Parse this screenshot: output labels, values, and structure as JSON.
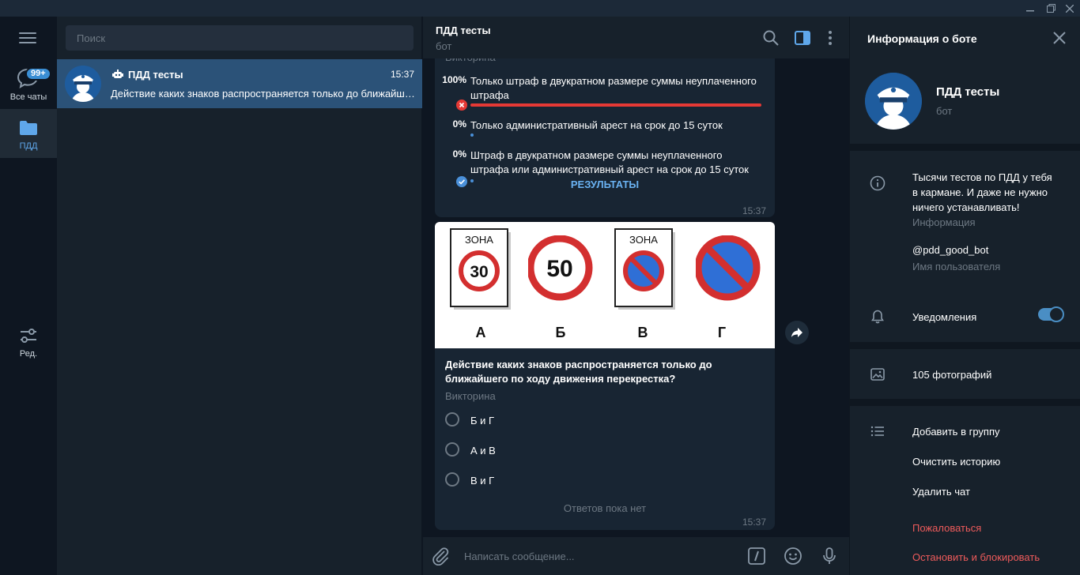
{
  "window": {
    "controls": [
      "minimize-icon",
      "maximize-icon",
      "close-icon"
    ]
  },
  "folders": {
    "items": [
      {
        "label": "Все чаты",
        "icon": "chat-bubbles-icon",
        "badge": "99+",
        "active": false
      },
      {
        "label": "ПДД",
        "icon": "folder-icon",
        "active": true
      },
      {
        "label": "Ред.",
        "icon": "edit-sliders-icon",
        "active": false
      }
    ]
  },
  "chatlist": {
    "search_placeholder": "Поиск",
    "chats": [
      {
        "name": "ПДД тесты",
        "time": "15:37",
        "preview": "Действие каких знаков распространяется только до ближайшего перекрестка?",
        "is_bot": true
      }
    ]
  },
  "chat": {
    "title": "ПДД тесты",
    "subtitle": "бот",
    "poll_header_partial": "Викторина",
    "poll1": {
      "options": [
        {
          "percent": "100%",
          "text": "Только штраф в двукратном размере суммы неуплаченного штрафа",
          "fill": 1.0,
          "mark": "wrong"
        },
        {
          "percent": "0%",
          "text": "Только административный арест на срок до 15 суток",
          "fill": 0.0,
          "mark": "none"
        },
        {
          "percent": "0%",
          "text": "Штраф в двукратном размере суммы неуплаченного штрафа или административный арест на срок до 15 суток",
          "fill": 0.0,
          "mark": "correct"
        }
      ],
      "results_label": "РЕЗУЛЬТАТЫ",
      "time": "15:37"
    },
    "image": {
      "signs": [
        {
          "caption": "А",
          "zone_label": "ЗОНА",
          "value": "30",
          "kind": "zone-speed-limit"
        },
        {
          "caption": "Б",
          "value": "50",
          "kind": "speed-limit"
        },
        {
          "caption": "В",
          "zone_label": "ЗОНА",
          "kind": "zone-no-parking"
        },
        {
          "caption": "Г",
          "kind": "no-parking"
        }
      ]
    },
    "poll2": {
      "question": "Действие каких знаков распространяется только до ближайшего по ходу движения перекрестка?",
      "kind": "Викторина",
      "options": [
        "Б и Г",
        "А и В",
        "В и Г"
      ],
      "footer": "Ответов пока нет",
      "time": "15:37"
    },
    "composer_placeholder": "Написать сообщение..."
  },
  "info": {
    "title": "Информация о боте",
    "name": "ПДД тесты",
    "status": "бот",
    "description": "Тысячи тестов по ПДД у тебя в кармане.  И даже не нужно ничего устанавливать!",
    "description_lines": [
      "Тысячи тестов по ПДД у тебя",
      "в кармане.  И даже не нужно",
      "ничего устанавливать!"
    ],
    "description_caption": "Информация",
    "username": "@pdd_good_bot",
    "username_caption": "Имя пользователя",
    "notifications_label": "Уведомления",
    "notifications_on": true,
    "photos_label": "105 фотографий",
    "actions": [
      "Добавить в группу",
      "Очистить историю",
      "Удалить чат"
    ],
    "danger_actions": [
      "Пожаловаться",
      "Остановить и блокировать"
    ]
  },
  "colors": {
    "accent": "#3a8ed4",
    "selected_chat": "#2b5278",
    "wrong": "#e53935",
    "correct": "#4a90d9",
    "danger_text": "#ef5b5b"
  }
}
